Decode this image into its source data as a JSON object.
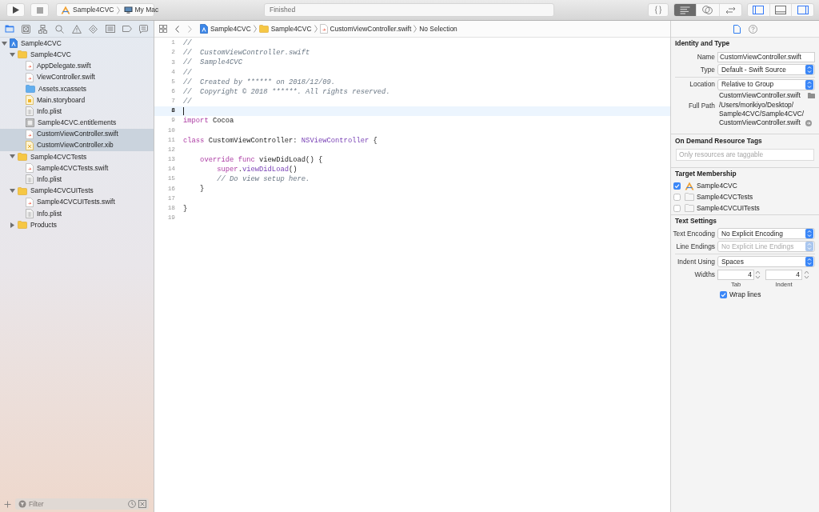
{
  "toolbar": {
    "scheme": {
      "target": "Sample4CVC",
      "destination": "My Mac"
    },
    "activity": "Finished",
    "editor_modes": [
      {
        "kind": "standard",
        "selected": true
      },
      {
        "kind": "assistant",
        "selected": false
      },
      {
        "kind": "version",
        "selected": false
      }
    ],
    "panels": [
      {
        "kind": "navigator",
        "on": true
      },
      {
        "kind": "debug",
        "on": false
      },
      {
        "kind": "utilities",
        "on": true
      }
    ]
  },
  "navigator": {
    "tabs": [
      {
        "kind": "project",
        "selected": true
      },
      {
        "kind": "source_control",
        "selected": false
      },
      {
        "kind": "symbol",
        "selected": false
      },
      {
        "kind": "find",
        "selected": false
      },
      {
        "kind": "issue",
        "selected": false
      },
      {
        "kind": "test",
        "selected": false
      },
      {
        "kind": "debug",
        "selected": false
      },
      {
        "kind": "breakpoint",
        "selected": false
      },
      {
        "kind": "report",
        "selected": false
      }
    ],
    "tree": [
      {
        "name": "Sample4CVC",
        "kind": "project",
        "selected": false,
        "expanded": true,
        "children": [
          {
            "name": "Sample4CVC",
            "kind": "folder",
            "selected": false,
            "expanded": true,
            "children": [
              {
                "name": "AppDelegate.swift",
                "kind": "swift",
                "selected": false
              },
              {
                "name": "ViewController.swift",
                "kind": "swift",
                "selected": false
              },
              {
                "name": "Assets.xcassets",
                "kind": "assets",
                "selected": false
              },
              {
                "name": "Main.storyboard",
                "kind": "storyboard",
                "selected": false
              },
              {
                "name": "Info.plist",
                "kind": "plist",
                "selected": false
              },
              {
                "name": "Sample4CVC.entitlements",
                "kind": "entitlements",
                "selected": false
              },
              {
                "name": "CustomViewController.swift",
                "kind": "swift",
                "selected": true
              },
              {
                "name": "CustomViewController.xib",
                "kind": "xib",
                "selected": true
              }
            ]
          },
          {
            "name": "Sample4CVCTests",
            "kind": "folder",
            "selected": false,
            "expanded": true,
            "children": [
              {
                "name": "Sample4CVCTests.swift",
                "kind": "swift",
                "selected": false
              },
              {
                "name": "Info.plist",
                "kind": "plist",
                "selected": false
              }
            ]
          },
          {
            "name": "Sample4CVCUITests",
            "kind": "folder",
            "selected": false,
            "expanded": true,
            "children": [
              {
                "name": "Sample4CVCUITests.swift",
                "kind": "swift",
                "selected": false
              },
              {
                "name": "Info.plist",
                "kind": "plist",
                "selected": false
              }
            ]
          },
          {
            "name": "Products",
            "kind": "folder",
            "selected": false,
            "expanded": false
          }
        ]
      }
    ],
    "filter": {
      "placeholder": "Filter"
    }
  },
  "editor": {
    "jump_bar": [
      {
        "kind": "project",
        "label": "Sample4CVC"
      },
      {
        "kind": "folder",
        "label": "Sample4CVC"
      },
      {
        "kind": "swift",
        "label": "CustomViewController.swift"
      },
      {
        "kind": "plain",
        "label": "No Selection"
      }
    ],
    "lines": [
      {
        "number": "1",
        "current": false,
        "tokens": [
          {
            "kind": "comment",
            "text": "//"
          }
        ]
      },
      {
        "number": "2",
        "current": false,
        "tokens": [
          {
            "kind": "comment",
            "text": "//  CustomViewController.swift"
          }
        ]
      },
      {
        "number": "3",
        "current": false,
        "tokens": [
          {
            "kind": "comment",
            "text": "//  Sample4CVC"
          }
        ]
      },
      {
        "number": "4",
        "current": false,
        "tokens": [
          {
            "kind": "comment",
            "text": "//"
          }
        ]
      },
      {
        "number": "5",
        "current": false,
        "tokens": [
          {
            "kind": "comment",
            "text": "//  Created by ****** on 2018/12/09."
          }
        ]
      },
      {
        "number": "6",
        "current": false,
        "tokens": [
          {
            "kind": "comment",
            "text": "//  Copyright © 2018 ******. All rights reserved."
          }
        ]
      },
      {
        "number": "7",
        "current": false,
        "tokens": [
          {
            "kind": "comment",
            "text": "//"
          }
        ]
      },
      {
        "number": "8",
        "current": true
      },
      {
        "number": "9",
        "current": false,
        "tokens": [
          {
            "kind": "keyword",
            "text": "import"
          },
          {
            "kind": "plain",
            "text": " Cocoa"
          }
        ]
      },
      {
        "number": "10",
        "current": false
      },
      {
        "number": "11",
        "current": false,
        "tokens": [
          {
            "kind": "keyword",
            "text": "class"
          },
          {
            "kind": "plain",
            "text": " CustomViewController: "
          },
          {
            "kind": "type",
            "text": "NSViewController"
          },
          {
            "kind": "plain",
            "text": " {"
          }
        ]
      },
      {
        "number": "12",
        "current": false
      },
      {
        "number": "13",
        "current": false,
        "tokens": [
          {
            "kind": "keyword",
            "text": "    override func"
          },
          {
            "kind": "plain",
            "text": " viewDidLoad() {"
          }
        ]
      },
      {
        "number": "14",
        "current": false,
        "tokens": [
          {
            "kind": "keyword",
            "text": "        super"
          },
          {
            "kind": "plain",
            "text": "."
          },
          {
            "kind": "method",
            "text": "viewDidLoad"
          },
          {
            "kind": "plain",
            "text": "()"
          }
        ]
      },
      {
        "number": "15",
        "current": false,
        "tokens": [
          {
            "kind": "comment",
            "text": "        // Do view setup here."
          }
        ]
      },
      {
        "number": "16",
        "current": false,
        "tokens": [
          {
            "kind": "plain",
            "text": "    }"
          }
        ]
      },
      {
        "number": "17",
        "current": false
      },
      {
        "number": "18",
        "current": false,
        "tokens": [
          {
            "kind": "plain",
            "text": "}"
          }
        ]
      },
      {
        "number": "19",
        "current": false
      }
    ]
  },
  "inspector": {
    "tabs": [
      {
        "kind": "file",
        "selected": true
      },
      {
        "kind": "help",
        "selected": false
      }
    ],
    "identity": {
      "title": "Identity and Type",
      "name": {
        "label": "Name",
        "value": "CustomViewController.swift"
      },
      "type": {
        "label": "Type",
        "value": "Default - Swift Source",
        "disabled": false
      },
      "location": {
        "label": "Location",
        "value": "Relative to Group",
        "disabled": false
      },
      "file_name": "CustomViewController.swift",
      "full_path": {
        "label": "Full Path",
        "lines": [
          "/Users/morikiyo/Desktop/",
          "Sample4CVC/Sample4CVC/",
          "CustomViewController.swift"
        ]
      }
    },
    "resource_tags": {
      "title": "On Demand Resource Tags",
      "placeholder": "Only resources are taggable"
    },
    "target_membership": {
      "title": "Target Membership",
      "targets": [
        {
          "name": "Sample4CVC",
          "kind": "app",
          "checked": true
        },
        {
          "name": "Sample4CVCTests",
          "kind": "bundle",
          "checked": false
        },
        {
          "name": "Sample4CVCUITests",
          "kind": "bundle",
          "checked": false
        }
      ]
    },
    "text_settings": {
      "title": "Text Settings",
      "text_encoding": {
        "label": "Text Encoding",
        "value": "No Explicit Encoding",
        "disabled": false
      },
      "line_endings": {
        "label": "Line Endings",
        "value": "No Explicit Line Endings",
        "disabled": true
      },
      "indent_using": {
        "label": "Indent Using",
        "value": "Spaces",
        "disabled": false
      },
      "widths": {
        "label": "Widths",
        "tab": {
          "value": "4",
          "caption": "Tab"
        },
        "indent": {
          "value": "4",
          "caption": "Indent"
        }
      },
      "wrap_lines": {
        "label": "Wrap lines",
        "checked": true
      }
    }
  }
}
